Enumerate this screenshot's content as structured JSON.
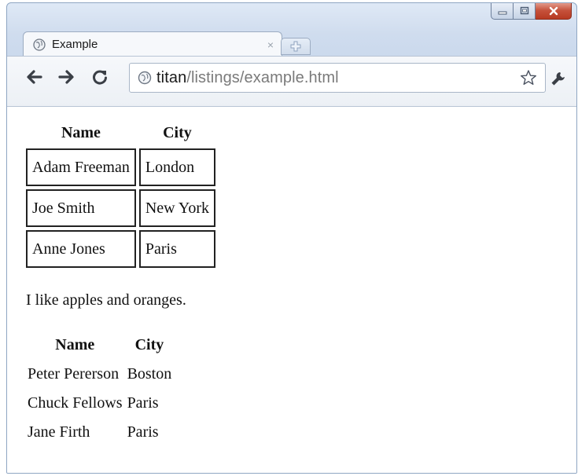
{
  "window": {
    "controls": {
      "minimize": "minimize-icon",
      "maximize": "maximize-icon",
      "close": "close-icon"
    }
  },
  "tab": {
    "title": "Example",
    "close_glyph": "×"
  },
  "toolbar": {
    "url_host": "titan",
    "url_path": "/listings/example.html"
  },
  "page": {
    "table1": {
      "headers": [
        "Name",
        "City"
      ],
      "rows": [
        [
          "Adam Freeman",
          "London"
        ],
        [
          "Joe Smith",
          "New York"
        ],
        [
          "Anne Jones",
          "Paris"
        ]
      ]
    },
    "paragraph": "I like apples and oranges.",
    "table2": {
      "headers": [
        "Name",
        "City"
      ],
      "rows": [
        [
          "Peter Pererson",
          "Boston"
        ],
        [
          "Chuck Fellows",
          "Paris"
        ],
        [
          "Jane Firth",
          "Paris"
        ]
      ]
    }
  },
  "colors": {
    "frame": "#c9d8ec",
    "close_button": "#c5503a"
  }
}
